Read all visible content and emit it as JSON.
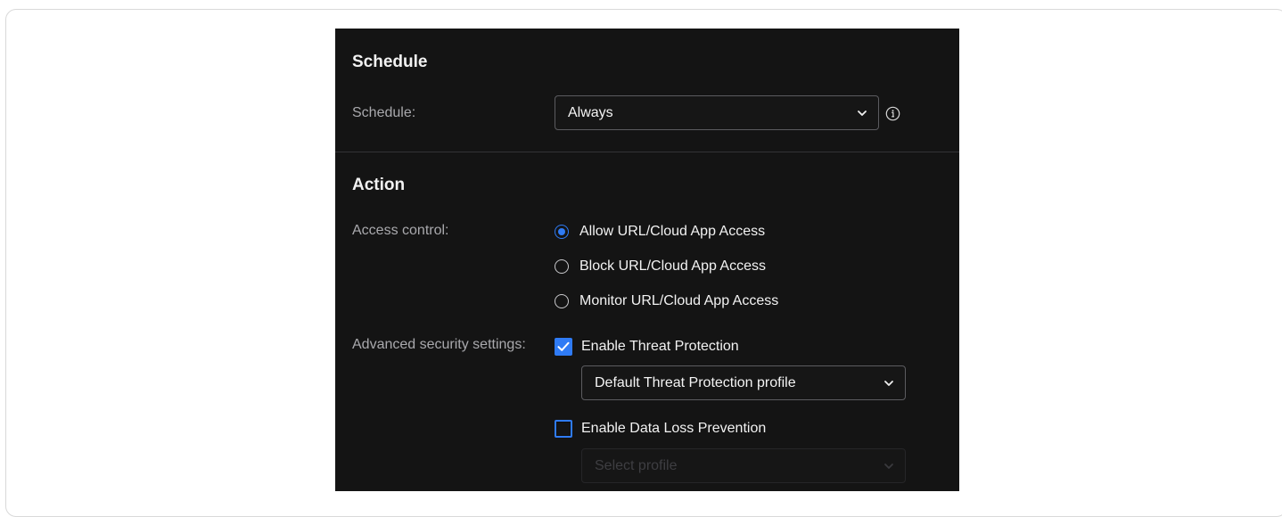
{
  "schedule_section": {
    "title": "Schedule",
    "field_label": "Schedule:",
    "select_value": "Always"
  },
  "action_section": {
    "title": "Action",
    "access_control": {
      "label": "Access control:",
      "options": [
        {
          "label": "Allow URL/Cloud App Access",
          "selected": true
        },
        {
          "label": "Block URL/Cloud App Access",
          "selected": false
        },
        {
          "label": "Monitor URL/Cloud App Access",
          "selected": false
        }
      ]
    },
    "advanced_security": {
      "label": "Advanced security settings:",
      "threat_protection": {
        "label": "Enable Threat Protection",
        "checked": true,
        "profile_value": "Default Threat Protection profile"
      },
      "data_loss_prevention": {
        "label": "Enable Data Loss Prevention",
        "checked": false,
        "profile_placeholder": "Select profile"
      }
    }
  },
  "colors": {
    "panel_background": "#141414",
    "accent": "#2f7bf5",
    "label_text": "#a9a9ad",
    "primary_text": "#f2f2f2"
  },
  "icons": {
    "select_chevron": "chevron-down-icon",
    "info": "info-icon",
    "checkmark": "checkmark-icon"
  }
}
